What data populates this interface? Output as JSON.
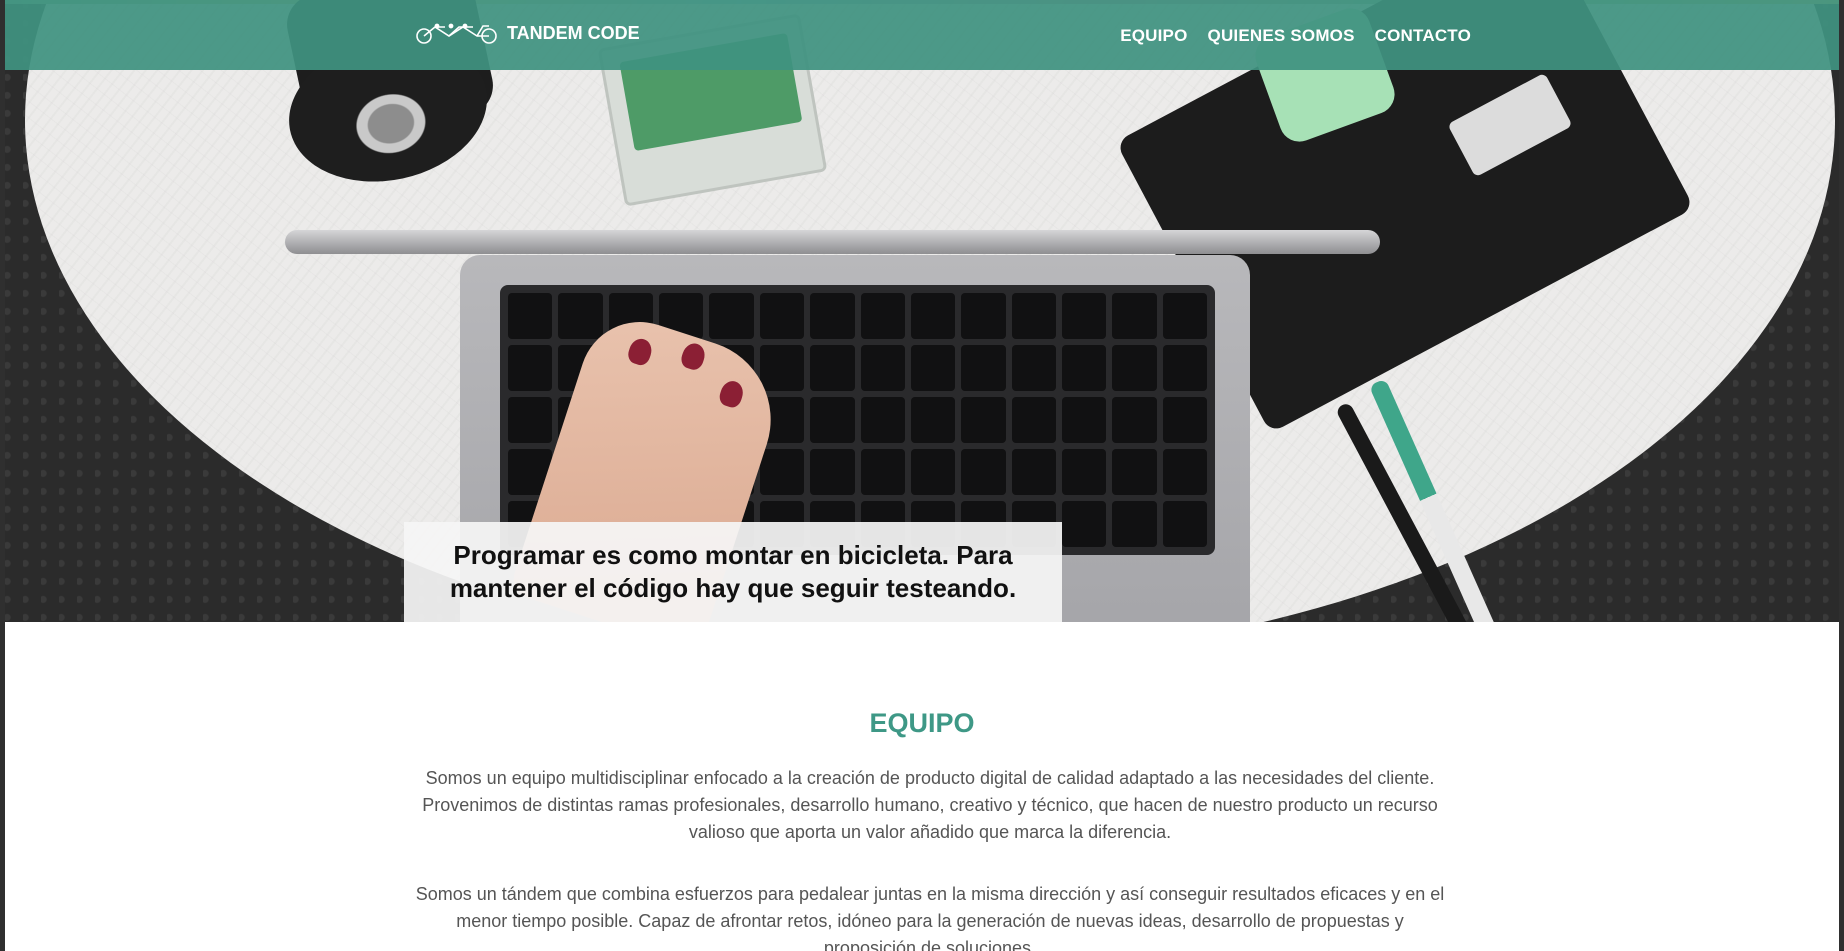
{
  "brand": {
    "name": "TANDEM CODE",
    "icon": "tandem-bike-icon"
  },
  "nav": {
    "items": [
      {
        "label": "EQUIPO"
      },
      {
        "label": "QUIENES SOMOS"
      },
      {
        "label": "CONTACTO"
      }
    ]
  },
  "hero": {
    "quote": "Programar es como montar en bicicleta. Para mantener el código hay que seguir testeando."
  },
  "equipo": {
    "title": "EQUIPO",
    "paragraphs": [
      "Somos un equipo multidisciplinar enfocado a la creación de producto digital de calidad adaptado a las necesidades del cliente. Provenimos de distintas ramas profesionales, desarrollo humano, creativo y técnico, que hacen de nuestro producto un recurso valioso que aporta un valor añadido que marca la diferencia.",
      "Somos un tándem que combina esfuerzos para pedalear juntas en la misma dirección y así conseguir resultados eficaces y en el menor tiempo posible. Capaz de afrontar retos, idóneo para la generación de nuevas ideas, desarrollo de propuestas y proposición de soluciones."
    ]
  },
  "colors": {
    "navbar": "#409280",
    "accent": "#3e9886",
    "text": "#555555"
  }
}
